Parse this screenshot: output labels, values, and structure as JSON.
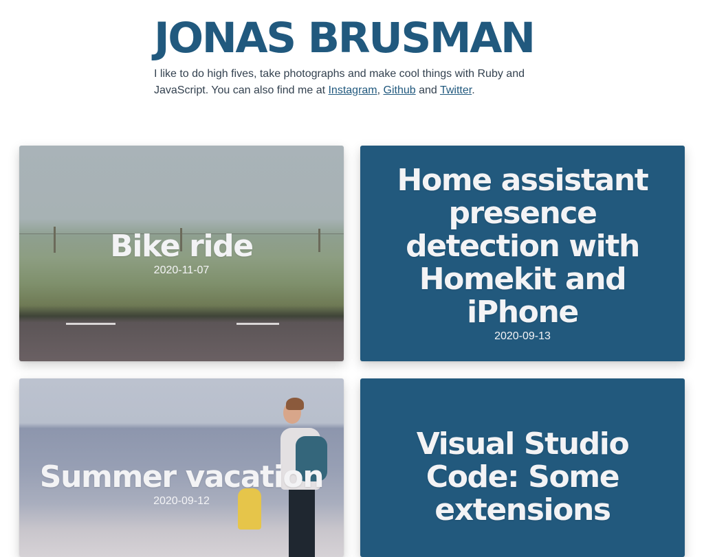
{
  "header": {
    "title": "JONAS BRUSMAN",
    "intro_text": "I like to do high fives, take photographs and make cool things with Ruby and JavaScript. You can also find me at ",
    "link_instagram": "Instagram",
    "sep_comma": ", ",
    "link_github": "Github",
    "sep_and": " and ",
    "link_twitter": "Twitter",
    "end_period": "."
  },
  "posts": [
    {
      "title": "Bike ride",
      "date": "2020-11-07",
      "has_photo": true
    },
    {
      "title": "Home assistant presence detection with Homekit and iPhone",
      "date": "2020-09-13",
      "has_photo": false
    },
    {
      "title": "Summer vacation",
      "date": "2020-09-12",
      "has_photo": true
    },
    {
      "title": "Visual Studio Code: Some extensions",
      "date": "",
      "has_photo": false
    }
  ],
  "colors": {
    "brand": "#21597e",
    "card_solid": "#22597d",
    "card_text": "#f3f3f5"
  }
}
